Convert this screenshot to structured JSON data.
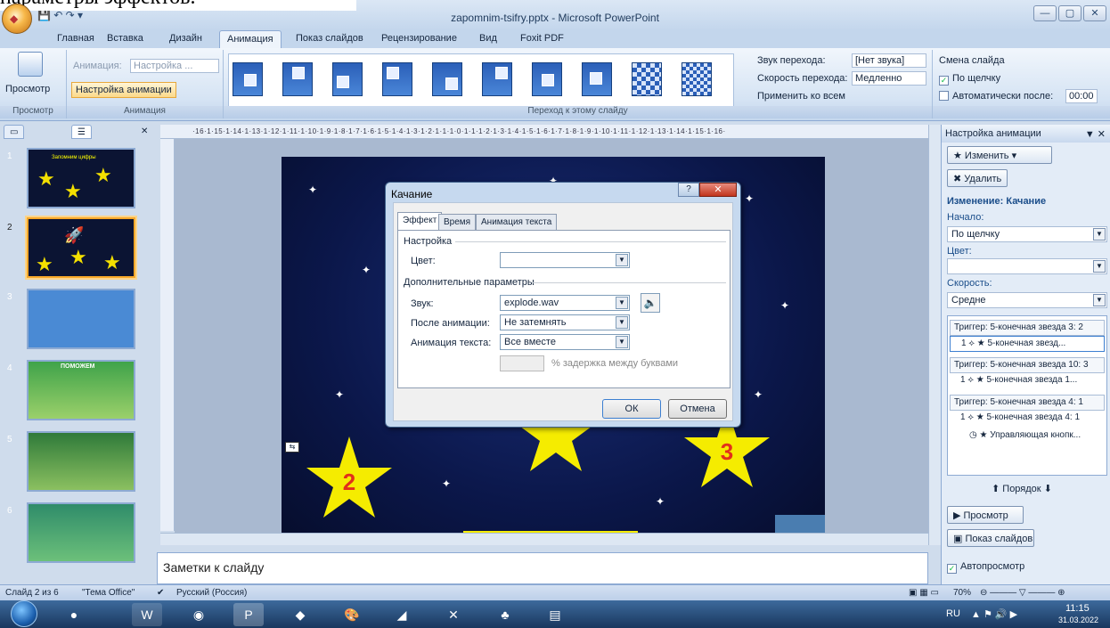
{
  "window": {
    "title": "zapomnim-tsifry.pptx - Microsoft PowerPoint",
    "top_text": "параметры эффектов."
  },
  "tabs": [
    "Главная",
    "Вставка",
    "Дизайн",
    "Анимация",
    "Показ слайдов",
    "Рецензирование",
    "Вид",
    "Foxit PDF"
  ],
  "ribbon": {
    "preview_btn": "Просмотр",
    "animation_label": "Анимация:",
    "animation_value": "Настройка ...",
    "custom_animation_btn": "Настройка анимации",
    "sound_label": "Звук перехода:",
    "sound_value": "[Нет звука]",
    "speed_label": "Скорость перехода:",
    "speed_value": "Медленно",
    "apply_all": "Применить ко всем",
    "change_slide": "Смена слайда",
    "on_click": "По щелчку",
    "auto_after": "Автоматически после:",
    "auto_time": "00:00",
    "group_preview": "Просмотр",
    "group_animation": "Анимация",
    "group_transition": "Переход к этому слайду"
  },
  "slides": [
    {
      "num": "1",
      "caption": "Запомним цифры"
    },
    {
      "num": "2"
    },
    {
      "num": "3"
    },
    {
      "num": "4",
      "caption": "ПОМОЖЕМ"
    },
    {
      "num": "5"
    },
    {
      "num": "6"
    }
  ],
  "ruler_text": "·16·1·15·1·14·1·13·1·12·1·11·1·10·1·9·1·8·1·7·1·6·1·5·1·4·1·3·1·2·1·1·1·0·1·1·1·2·1·3·1·4·1·5·1·6·1·7·1·8·1·9·1·10·1·11·1·12·1·13·1·14·1·15·1·16·",
  "slide": {
    "star_left": "2",
    "star_right": "3"
  },
  "notes_placeholder": "Заметки к слайду",
  "dialog": {
    "title": "Качание",
    "help": "?",
    "close": "✕",
    "tabs": [
      "Эффект",
      "Время",
      "Анимация текста"
    ],
    "section_settings": "Настройка",
    "color_label": "Цвет:",
    "section_extra": "Дополнительные параметры",
    "sound_label": "Звук:",
    "sound_value": "explode.wav",
    "after_label": "После анимации:",
    "after_value": "Не затемнять",
    "text_anim_label": "Анимация текста:",
    "text_anim_value": "Все вместе",
    "delay_label": "% задержка между буквами",
    "ok": "ОК",
    "cancel": "Отмена"
  },
  "taskpane": {
    "title": "Настройка анимации",
    "change_btn": "Изменить",
    "delete_btn": "Удалить",
    "change_header": "Изменение: Качание",
    "start_label": "Начало:",
    "start_value": "По щелчку",
    "color_label": "Цвет:",
    "speed_label": "Скорость:",
    "speed_value": "Средне",
    "list": [
      {
        "trigger": "Триггер: 5-конечная звезда 3: 2",
        "item": "5-конечная звезд..."
      },
      {
        "trigger": "Триггер: 5-конечная звезда 10: 3",
        "item": "5-конечная звезда 1..."
      },
      {
        "trigger": "Триггер: 5-конечная звезда 4: 1",
        "item": "5-конечная звезда 4: 1",
        "item2": "Управляющая кнопк..."
      }
    ],
    "item_num": "1",
    "order_label": "Порядок",
    "play_btn": "Просмотр",
    "show_btn": "Показ слайдов",
    "autopreview": "Автопросмотр"
  },
  "status": {
    "slide": "Слайд 2 из 6",
    "theme": "\"Тема Office\"",
    "lang": "Русский (Россия)",
    "zoom": "70%"
  },
  "taskbar": {
    "lang": "RU",
    "time": "11:15",
    "date": "31.03.2022"
  },
  "colors": {
    "accent": "#f7a829",
    "ribbon": "#d6e4f4",
    "star": "#f5ec00",
    "star_number": "#e2301a"
  }
}
